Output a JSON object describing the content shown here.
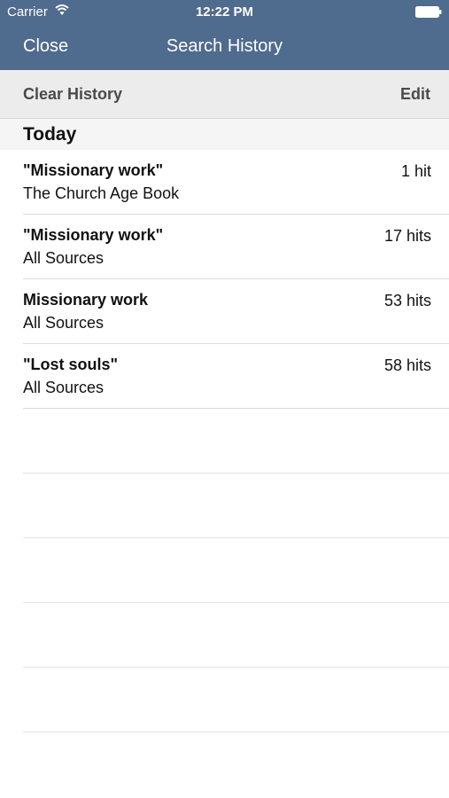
{
  "status_bar": {
    "carrier": "Carrier",
    "time": "12:22 PM"
  },
  "nav": {
    "close_label": "Close",
    "title": "Search History"
  },
  "toolbar": {
    "clear_label": "Clear History",
    "edit_label": "Edit"
  },
  "section": {
    "title": "Today"
  },
  "history": [
    {
      "query": "\"Missionary work\"",
      "source": "The Church Age Book",
      "hits": "1 hit"
    },
    {
      "query": "\"Missionary work\"",
      "source": "All Sources",
      "hits": "17 hits"
    },
    {
      "query": "Missionary work",
      "source": "All Sources",
      "hits": "53 hits"
    },
    {
      "query": "\"Lost souls\"",
      "source": "All Sources",
      "hits": "58 hits"
    }
  ],
  "colors": {
    "nav_background": "#4f6b8d",
    "toolbar_background": "#ececec",
    "section_background": "#f5f5f5"
  }
}
